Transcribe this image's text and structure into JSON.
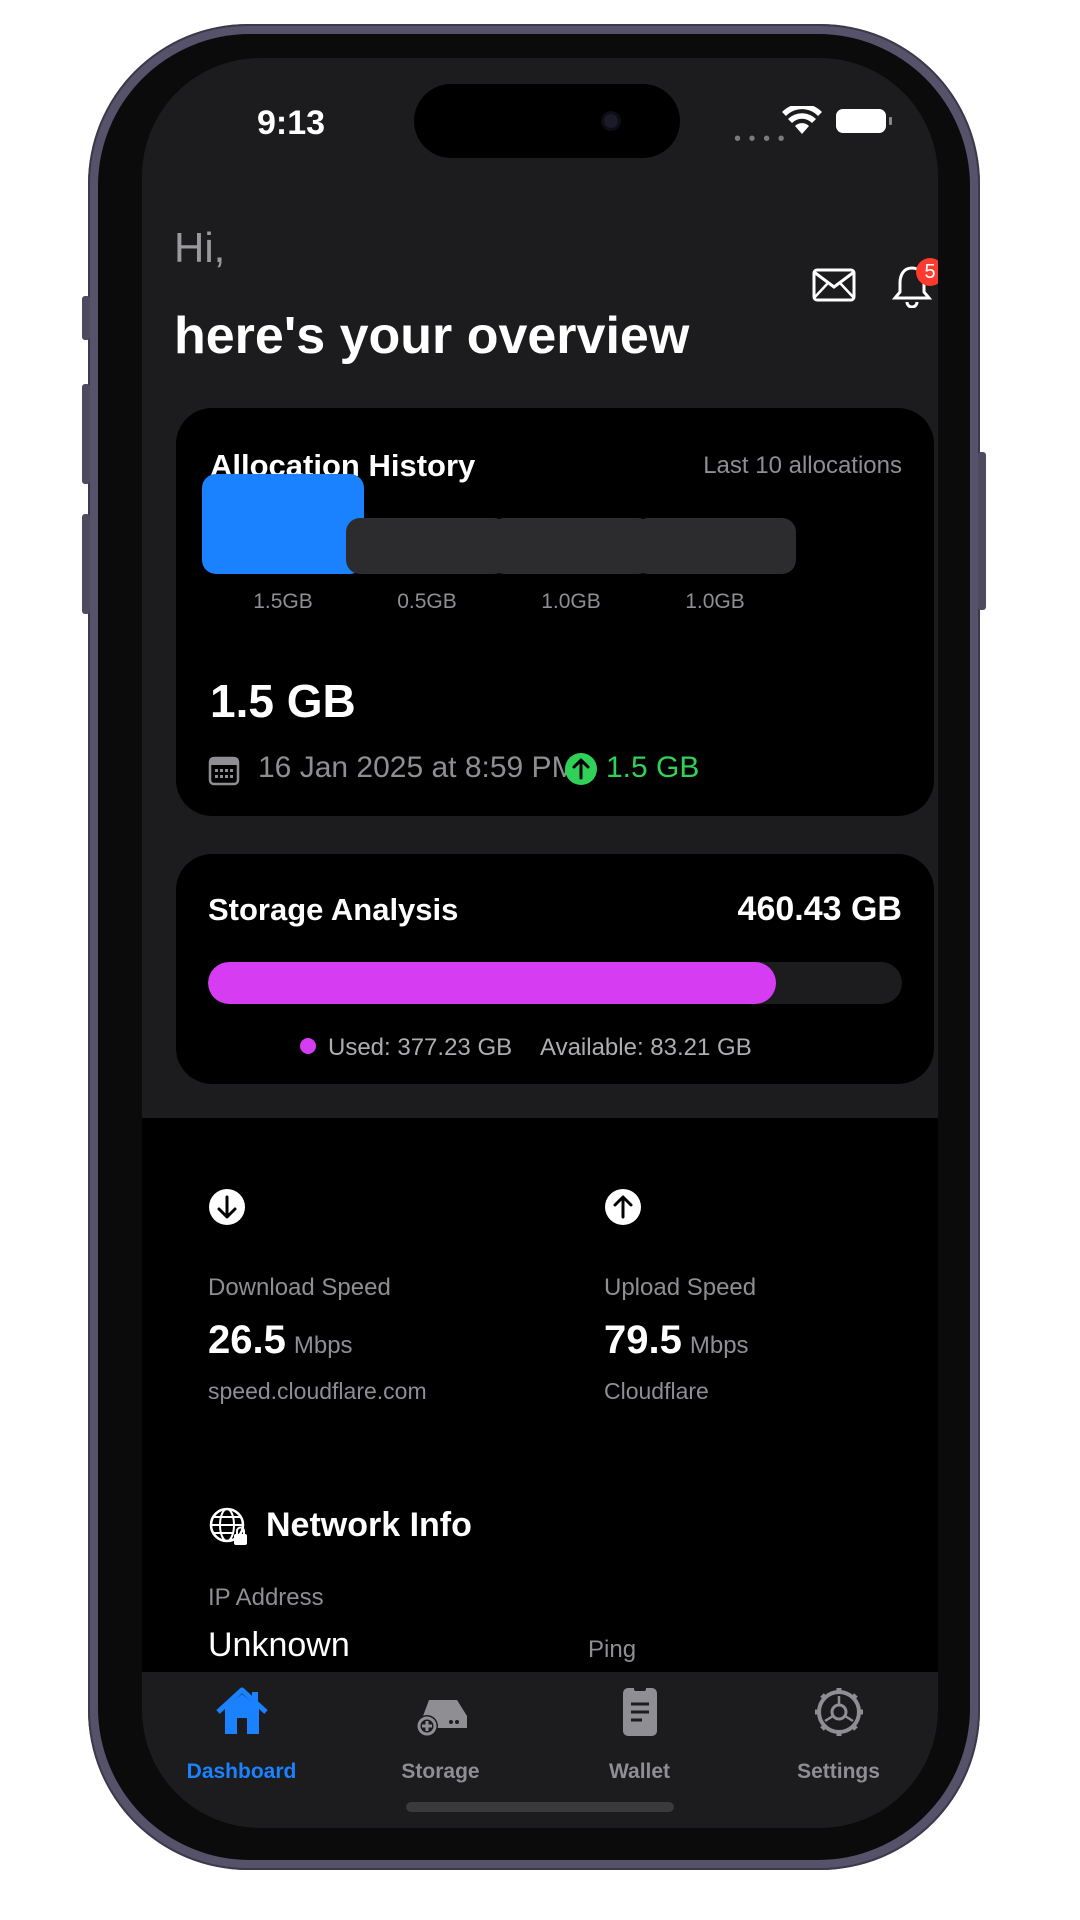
{
  "status_bar": {
    "time": "9:13"
  },
  "header": {
    "greeting": "Hi,",
    "title": "here's your overview",
    "notification_count": "5"
  },
  "allocation_history": {
    "title": "Allocation History",
    "subtitle": "Last 10 allocations",
    "bars": [
      {
        "label": "1.5GB",
        "value_gb": 1.5,
        "selected": true
      },
      {
        "label": "0.5GB",
        "value_gb": 0.5,
        "selected": false
      },
      {
        "label": "1.0GB",
        "value_gb": 1.0,
        "selected": false
      },
      {
        "label": "1.0GB",
        "value_gb": 1.0,
        "selected": false
      }
    ],
    "selected_value": "1.5 GB",
    "selected_date": "16 Jan 2025 at 8:59 PM",
    "selected_change": "1.5 GB"
  },
  "storage_analysis": {
    "title": "Storage Analysis",
    "total": "460.43 GB",
    "used_fraction": 0.819,
    "used_label": "Used: 377.23 GB",
    "available_label": "Available: 83.21 GB"
  },
  "download": {
    "label": "Download Speed",
    "value": "26.5",
    "unit": "Mbps",
    "source": "speed.cloudflare.com"
  },
  "upload": {
    "label": "Upload Speed",
    "value": "79.5",
    "unit": "Mbps",
    "source": "Cloudflare"
  },
  "network_info": {
    "title": "Network Info",
    "ip_label": "IP Address",
    "ip_value": "Unknown",
    "ping_label": "Ping"
  },
  "tabbar": {
    "tabs": [
      {
        "label": "Dashboard",
        "icon": "home-icon",
        "active": true
      },
      {
        "label": "Storage",
        "icon": "storage-icon",
        "active": false
      },
      {
        "label": "Wallet",
        "icon": "wallet-icon",
        "active": false
      },
      {
        "label": "Settings",
        "icon": "gear-icon",
        "active": false
      }
    ]
  },
  "colors": {
    "accent": "#1a82ff",
    "storage_used": "#d63cf2",
    "positive": "#30d158",
    "badge": "#ff3b30"
  }
}
